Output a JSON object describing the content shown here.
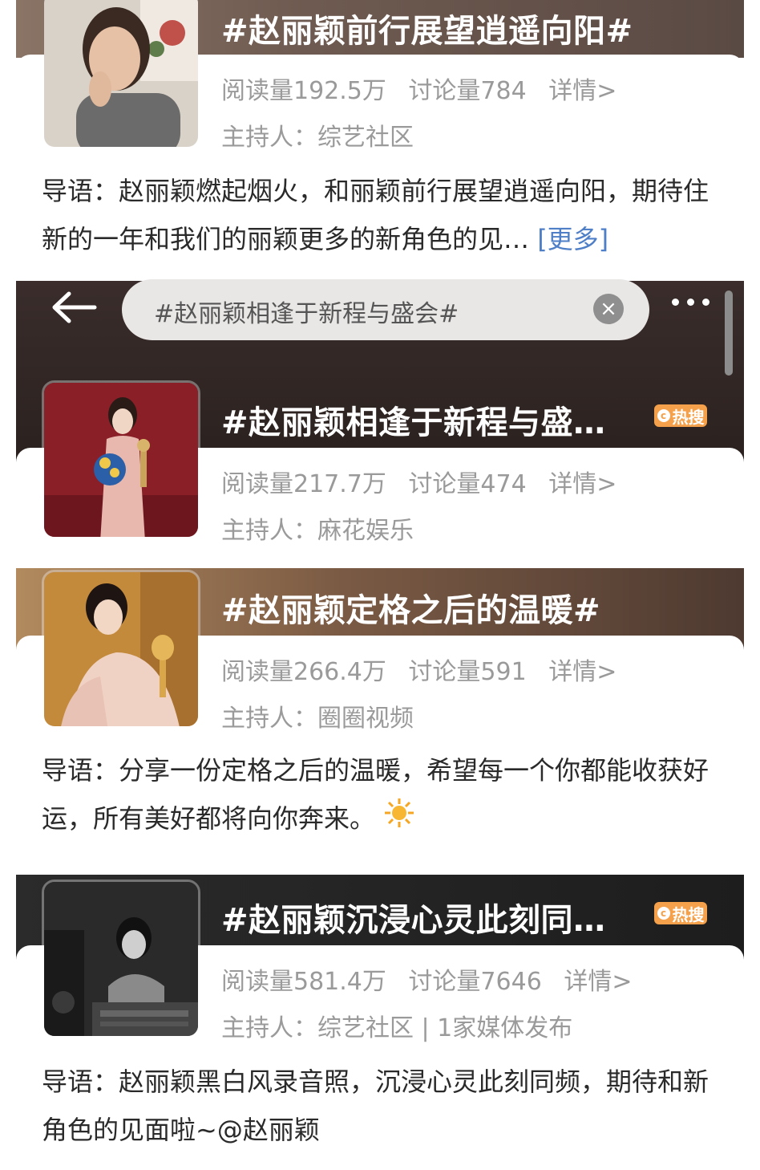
{
  "topics": [
    {
      "title": "#赵丽颖前行展望逍遥向阳#",
      "reads": "阅读量192.5万",
      "discussions": "讨论量784",
      "details": "详情>",
      "host": "主持人：综艺社区",
      "intro": "导语：赵丽颖燃起烟火，和丽颖前行展望逍遥向阳，期待住新的一年和我们的丽颖更多的新角色的见…",
      "more": "[更多]"
    },
    {
      "title": "#赵丽颖相逢于新程与盛…",
      "badge": "热搜",
      "reads": "阅读量217.7万",
      "discussions": "讨论量474",
      "details": "详情>",
      "host": "主持人：麻花娱乐"
    },
    {
      "title": "#赵丽颖定格之后的温暖#",
      "reads": "阅读量266.4万",
      "discussions": "讨论量591",
      "details": "详情>",
      "host": "主持人：圈圈视频",
      "intro": "导语：分享一份定格之后的温暖，希望每一个你都能收获好运，所有美好都将向你奔来。"
    },
    {
      "title": "#赵丽颖沉浸心灵此刻同…",
      "badge": "热搜",
      "reads": "阅读量581.4万",
      "discussions": "讨论量7646",
      "details": "详情>",
      "host": "主持人：综艺社区 | 1家媒体发布",
      "intro": "导语：赵丽颖黑白风录音照，沉浸心灵此刻同频，期待和新角色的见面啦~@赵丽颖"
    }
  ],
  "search": {
    "query": "#赵丽颖相逢于新程与盛会#"
  },
  "icons": {
    "back": "arrow-left-icon",
    "clear": "clear-x-icon",
    "more": "more-dots-icon",
    "sun": "sun-emoji-icon"
  },
  "colors": {
    "link": "#4f7fc6",
    "badge": "#f5a04a",
    "meta_text": "#9a9a9a"
  }
}
